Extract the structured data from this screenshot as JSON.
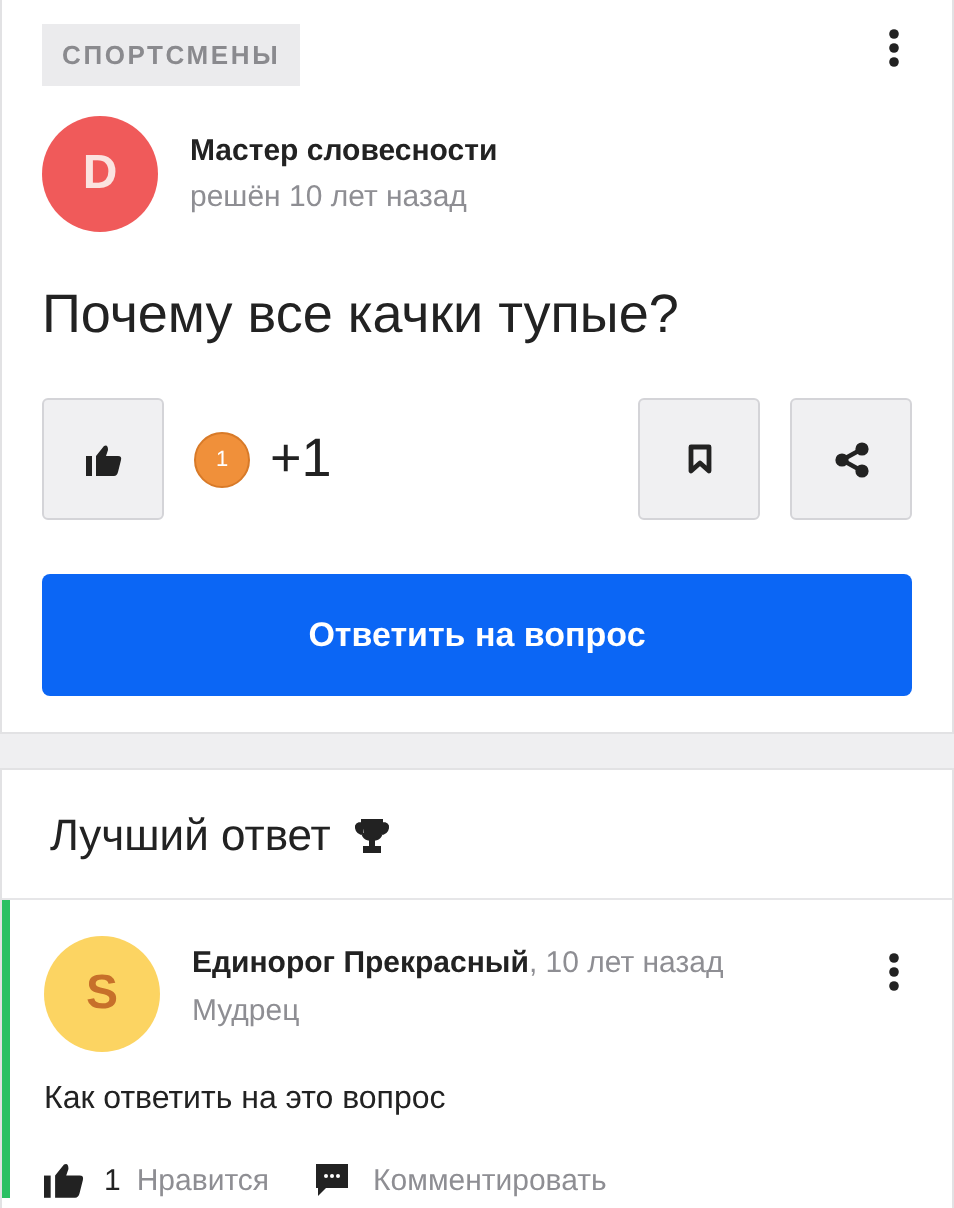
{
  "question": {
    "category": "СПОРТСМЕНЫ",
    "author": {
      "initial": "D",
      "color": "#f05a5a",
      "name": "Мастер словесности",
      "status": "решён 10 лет назад"
    },
    "title": "Почему все качки тупые?",
    "rating_badge": "1",
    "score": "+1",
    "answer_button": "Ответить на вопрос"
  },
  "best_answer": {
    "heading": "Лучший ответ",
    "author": {
      "initial": "S",
      "color": "#fcd462",
      "name": "Единорог Прекрасный",
      "time": ", 10 лет назад",
      "rank": "Мудрец"
    },
    "text": "Как ответить на это вопрос",
    "likes": "1",
    "like_label": "Нравится",
    "comment_label": "Комментировать"
  }
}
